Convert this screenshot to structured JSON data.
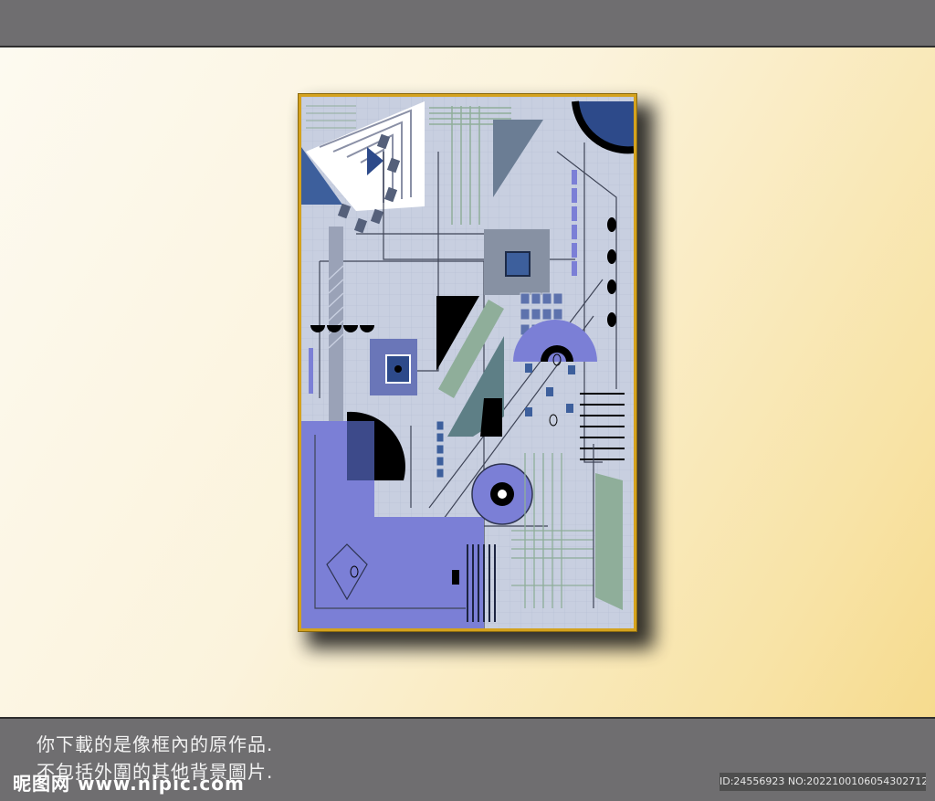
{
  "caption": {
    "line1": "你下載的是像框內的原作品.",
    "line2": "不包括外圍的其他背景圖片."
  },
  "watermark": "昵图网 www.nipic.com",
  "image_id": "ID:24556923 NO:20221001060543027128",
  "colors": {
    "band": "#6f6e70",
    "frame": "#d4a21e",
    "art_background": "#c8cfe0",
    "periwinkle": "#7b7fd6",
    "steel_blue": "#3d5f9c",
    "sage_green": "#8fae9a",
    "slate": "#6b7d94",
    "black": "#000000"
  }
}
